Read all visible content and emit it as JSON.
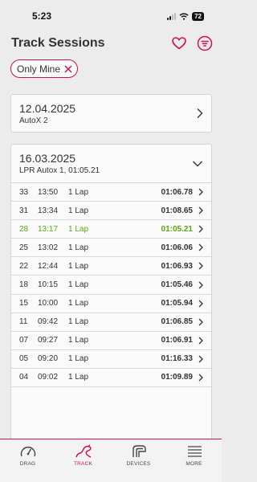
{
  "status_bar": {
    "time": "5:23",
    "battery": "72"
  },
  "header": {
    "title": "Track Sessions",
    "favorite_icon": "heart-icon",
    "filter_icon": "filter-icon"
  },
  "filter": {
    "chip_label": "Only Mine",
    "remove_icon": "close-icon"
  },
  "sessions": [
    {
      "date": "12.04.2025",
      "subtitle": "AutoX 2",
      "expanded": false
    },
    {
      "date": "16.03.2025",
      "subtitle": "LPR Autox 1, 01:05.21",
      "expanded": true
    }
  ],
  "laps": [
    {
      "num": "33",
      "time": "13:50",
      "laps": "1 Lap",
      "best": "01:06.78",
      "is_best": false
    },
    {
      "num": "31",
      "time": "13:34",
      "laps": "1 Lap",
      "best": "01:08.65",
      "is_best": false
    },
    {
      "num": "28",
      "time": "13:17",
      "laps": "1 Lap",
      "best": "01:05.21",
      "is_best": true
    },
    {
      "num": "25",
      "time": "13:02",
      "laps": "1 Lap",
      "best": "01:06.06",
      "is_best": false
    },
    {
      "num": "22",
      "time": "12:44",
      "laps": "1 Lap",
      "best": "01:06.93",
      "is_best": false
    },
    {
      "num": "18",
      "time": "10:15",
      "laps": "1 Lap",
      "best": "01:05.46",
      "is_best": false
    },
    {
      "num": "15",
      "time": "10:00",
      "laps": "1 Lap",
      "best": "01:05.94",
      "is_best": false
    },
    {
      "num": "11",
      "time": "09:42",
      "laps": "1 Lap",
      "best": "01:06.85",
      "is_best": false
    },
    {
      "num": "07",
      "time": "09:27",
      "laps": "1 Lap",
      "best": "01:06.91",
      "is_best": false
    },
    {
      "num": "05",
      "time": "09:20",
      "laps": "1 Lap",
      "best": "01:16.33",
      "is_best": false
    },
    {
      "num": "04",
      "time": "09:02",
      "laps": "1 Lap",
      "best": "01:09.89",
      "is_best": false
    }
  ],
  "tabs": [
    {
      "label": "DRAG",
      "icon": "gauge-icon",
      "active": false
    },
    {
      "label": "TRACK",
      "icon": "track-icon",
      "active": true
    },
    {
      "label": "DEVICES",
      "icon": "devices-icon",
      "active": false
    },
    {
      "label": "MORE",
      "icon": "menu-icon",
      "active": false
    }
  ],
  "colors": {
    "accent": "#d0104c",
    "best_lap": "#5aa812",
    "background": "#ececec"
  }
}
